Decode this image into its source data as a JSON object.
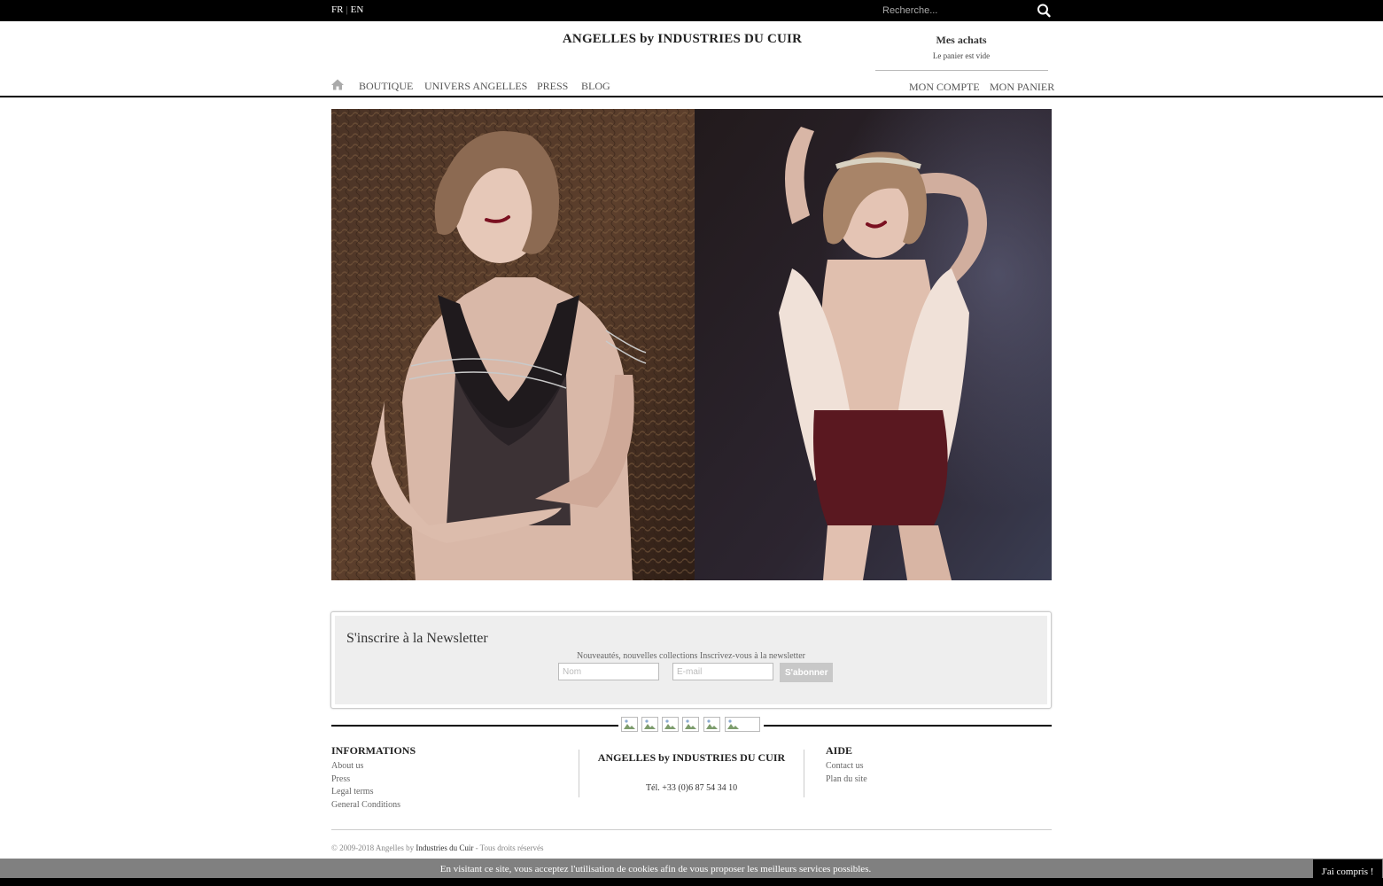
{
  "topbar": {
    "lang_fr": "FR",
    "lang_sep": "|",
    "lang_en": "EN",
    "search_placeholder": "Recherche...",
    "search_icon": "search-icon"
  },
  "header": {
    "brand": "ANGELLES by INDUSTRIES DU CUIR",
    "cart_title": "Mes achats",
    "cart_status": "Le panier est vide"
  },
  "nav": {
    "home_icon": "home-icon",
    "items": [
      "BOUTIQUE",
      "UNIVERS ANGELLES",
      "PRESS",
      "BLOG"
    ],
    "account": "MON COMPTE",
    "cart": "MON PANIER"
  },
  "newsletter": {
    "title": "S'inscrire à la Newsletter",
    "subtitle": "Nouveautés, nouvelles collections Inscrivez-vous à la newsletter",
    "name_placeholder": "Nom",
    "email_placeholder": "E-mail",
    "submit": "S'abonner"
  },
  "footer": {
    "informations": {
      "heading": "INFORMATIONS",
      "links": [
        "About us",
        "Press",
        "Legal terms",
        "General Conditions"
      ]
    },
    "center": {
      "brand": "ANGELLES by INDUSTRIES DU CUIR",
      "tel": "Tél. +33 (0)6 87 54 34 10"
    },
    "aide": {
      "heading": "AIDE",
      "links": [
        "Contact us",
        "Plan du site"
      ]
    },
    "copyright_prefix": "© 2009-2018 Angelles by ",
    "copyright_link": "Industries du Cuir",
    "copyright_suffix": " - Tous droits réservés"
  },
  "cookie": {
    "text": "En visitant ce site, vous acceptez l'utilisation de cookies afin de vous proposer les meilleurs services possibles.",
    "accept": "J'ai compris !"
  }
}
